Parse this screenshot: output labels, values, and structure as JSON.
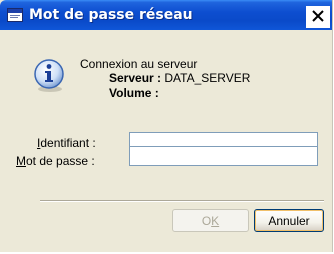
{
  "window": {
    "title": "Mot de passe réseau",
    "icon": "window-icon",
    "close_glyph": "✕"
  },
  "message": {
    "icon": "info-icon",
    "line1": "Connexion au serveur",
    "server_label": "Serveur :",
    "server_value": "DATA_SERVER",
    "volume_label": "Volume :",
    "volume_value": ""
  },
  "form": {
    "username": {
      "label_accel": "I",
      "label_rest": "dentifiant :",
      "value": ""
    },
    "password": {
      "label_accel": "M",
      "label_rest": "ot de passe :",
      "value": ""
    }
  },
  "buttons": {
    "ok": {
      "label_pre": "O",
      "label_accel": "K",
      "enabled": false
    },
    "cancel": {
      "label": "Annuler",
      "enabled": true
    }
  },
  "colors": {
    "titlebar": "#0a4ac9",
    "dialog_bg": "#ece9d8",
    "input_border": "#7f9db9"
  }
}
